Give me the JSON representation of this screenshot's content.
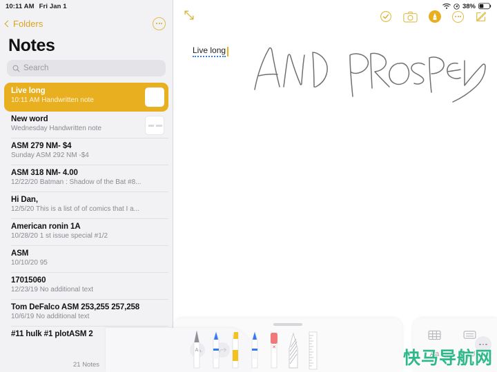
{
  "status_bar": {
    "time": "10:11 AM",
    "date": "Fri Jan 1",
    "wifi_icon": "wifi-icon",
    "location_icon": "location-icon",
    "battery_percent": "38%",
    "battery_icon": "battery-icon"
  },
  "sidebar": {
    "back_label": "Folders",
    "back_icon": "chevron-left-icon",
    "more_icon": "ellipsis-circle-icon",
    "title": "Notes",
    "search": {
      "placeholder": "Search",
      "icon": "search-icon",
      "value": ""
    },
    "notes": [
      {
        "title": "Live long",
        "meta": "10:11 AM  Handwritten note",
        "selected": true,
        "thumb": "handwriting-thumbnail"
      },
      {
        "title": "New word",
        "meta": "Wednesday  Handwritten note",
        "selected": false,
        "thumb": "handwriting-thumbnail"
      },
      {
        "title": "ASM 279 NM- $4",
        "meta": "Sunday  ASM 292 NM -$4",
        "selected": false,
        "thumb": ""
      },
      {
        "title": "ASM 318  NM- 4.00",
        "meta": "12/22/20  Batman : Shadow of the Bat #8...",
        "selected": false,
        "thumb": ""
      },
      {
        "title": "Hi Dan,",
        "meta": "12/5/20  This is a list of of comics that I a...",
        "selected": false,
        "thumb": ""
      },
      {
        "title": "American ronin 1A",
        "meta": "10/28/20  1 st issue special #1/2",
        "selected": false,
        "thumb": ""
      },
      {
        "title": "ASM",
        "meta": "10/10/20  95",
        "selected": false,
        "thumb": ""
      },
      {
        "title": "17015060",
        "meta": "12/23/19  No additional text",
        "selected": false,
        "thumb": ""
      },
      {
        "title": "Tom DeFalco ASM 253,255 257,258",
        "meta": "10/6/19  No additional text",
        "selected": false,
        "thumb": ""
      },
      {
        "title": "#11 hulk #1 plotASM 2",
        "meta": "",
        "selected": false,
        "thumb": ""
      }
    ],
    "count_label": "21 Notes"
  },
  "detail": {
    "expand_icon": "expand-arrows-icon",
    "toolbar_icons": [
      {
        "name": "checklist-circle-icon",
        "label": "Done"
      },
      {
        "name": "camera-icon",
        "label": "Camera"
      },
      {
        "name": "markup-pen-icon",
        "label": "Markup"
      },
      {
        "name": "ellipsis-circle-icon",
        "label": "More"
      },
      {
        "name": "compose-icon",
        "label": "New Note"
      }
    ],
    "note_title": "Live long",
    "handwriting_text": "AND PROSPER",
    "cursor_color": "#e8b020",
    "spellcheck_underline_color": "#3478f6"
  },
  "palette": {
    "grabber": "drag-handle",
    "undo_icon": "undo-icon",
    "redo_icon": "redo-icon",
    "tools": [
      {
        "name": "pen-tool",
        "label": "Pen",
        "color": "#b8b8bd"
      },
      {
        "name": "marker-tool",
        "label": "Marker",
        "color": "#3478f6"
      },
      {
        "name": "highlighter-tool",
        "label": "Highlighter",
        "color": "#f3c220"
      },
      {
        "name": "pencil-tool",
        "label": "Pencil",
        "color": "#3478f6"
      },
      {
        "name": "eraser-tool",
        "label": "Eraser",
        "color": "#f07a7a"
      },
      {
        "name": "lasso-tool",
        "label": "Lasso",
        "color": "#b0b0b5"
      },
      {
        "name": "ruler-tool",
        "label": "Ruler",
        "color": "#c0c0c5"
      }
    ],
    "right_buttons": [
      {
        "name": "table-icon",
        "label": "Table"
      },
      {
        "name": "keyboard-icon",
        "label": "Keyboard"
      },
      {
        "name": "format-aa-icon",
        "label": "Aa"
      },
      {
        "name": "return-icon",
        "label": "Return"
      }
    ],
    "more_icon": "ellipsis-icon"
  },
  "watermark": {
    "text": "快马导航网",
    "color": "#2fb98b"
  }
}
